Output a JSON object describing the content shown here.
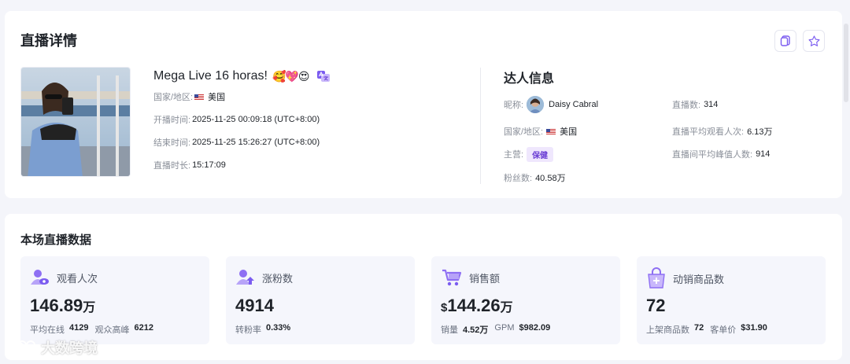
{
  "detail": {
    "title": "直播详情",
    "live_title": "Mega Live 16 horas!",
    "live_emojis": "🥰💖😍",
    "rows": [
      {
        "label": "国家/地区:",
        "value": "美国",
        "flag": true
      },
      {
        "label": "开播时间:",
        "value": "2025-11-25 00:09:18 (UTC+8:00)"
      },
      {
        "label": "结束时间:",
        "value": "2025-11-25 15:26:27 (UTC+8:00)"
      },
      {
        "label": "直播时长:",
        "value": "15:17:09"
      }
    ]
  },
  "creator": {
    "title": "达人信息",
    "nickname_label": "昵称:",
    "nickname": "Daisy Cabral",
    "region_label": "国家/地区:",
    "region": "美国",
    "category_label": "主营:",
    "category": "保健",
    "followers_label": "粉丝数:",
    "followers": "40.58万",
    "lives_label": "直播数:",
    "lives": "314",
    "avg_viewers_label": "直播平均观看人次:",
    "avg_viewers": "6.13万",
    "avg_peak_label": "直播间平均峰值人数:",
    "avg_peak": "914"
  },
  "stats": {
    "title": "本场直播数据",
    "cards": [
      {
        "label": "观看人次",
        "value": "146.89",
        "unit": "万",
        "sub1_label": "平均在线",
        "sub1_value": "4129",
        "sub2_label": "观众高峰",
        "sub2_value": "6212"
      },
      {
        "label": "涨粉数",
        "value": "4914",
        "unit": "",
        "sub1_label": "转粉率",
        "sub1_value": "0.33%"
      },
      {
        "label": "销售额",
        "currency": "$",
        "value": "144.26",
        "unit": "万",
        "sub1_label": "销量",
        "sub1_value": "4.52万",
        "sub2_label": "GPM",
        "sub2_value": "$982.09"
      },
      {
        "label": "动销商品数",
        "value": "72",
        "unit": "",
        "sub1_label": "上架商品数",
        "sub1_value": "72",
        "sub2_label": "客单价",
        "sub2_value": "$31.90"
      }
    ]
  },
  "watermark": "大数跨境",
  "colors": {
    "accent": "#7b5cf0",
    "tag_bg": "#efe7fd",
    "card_bg": "#f5f6fc"
  }
}
